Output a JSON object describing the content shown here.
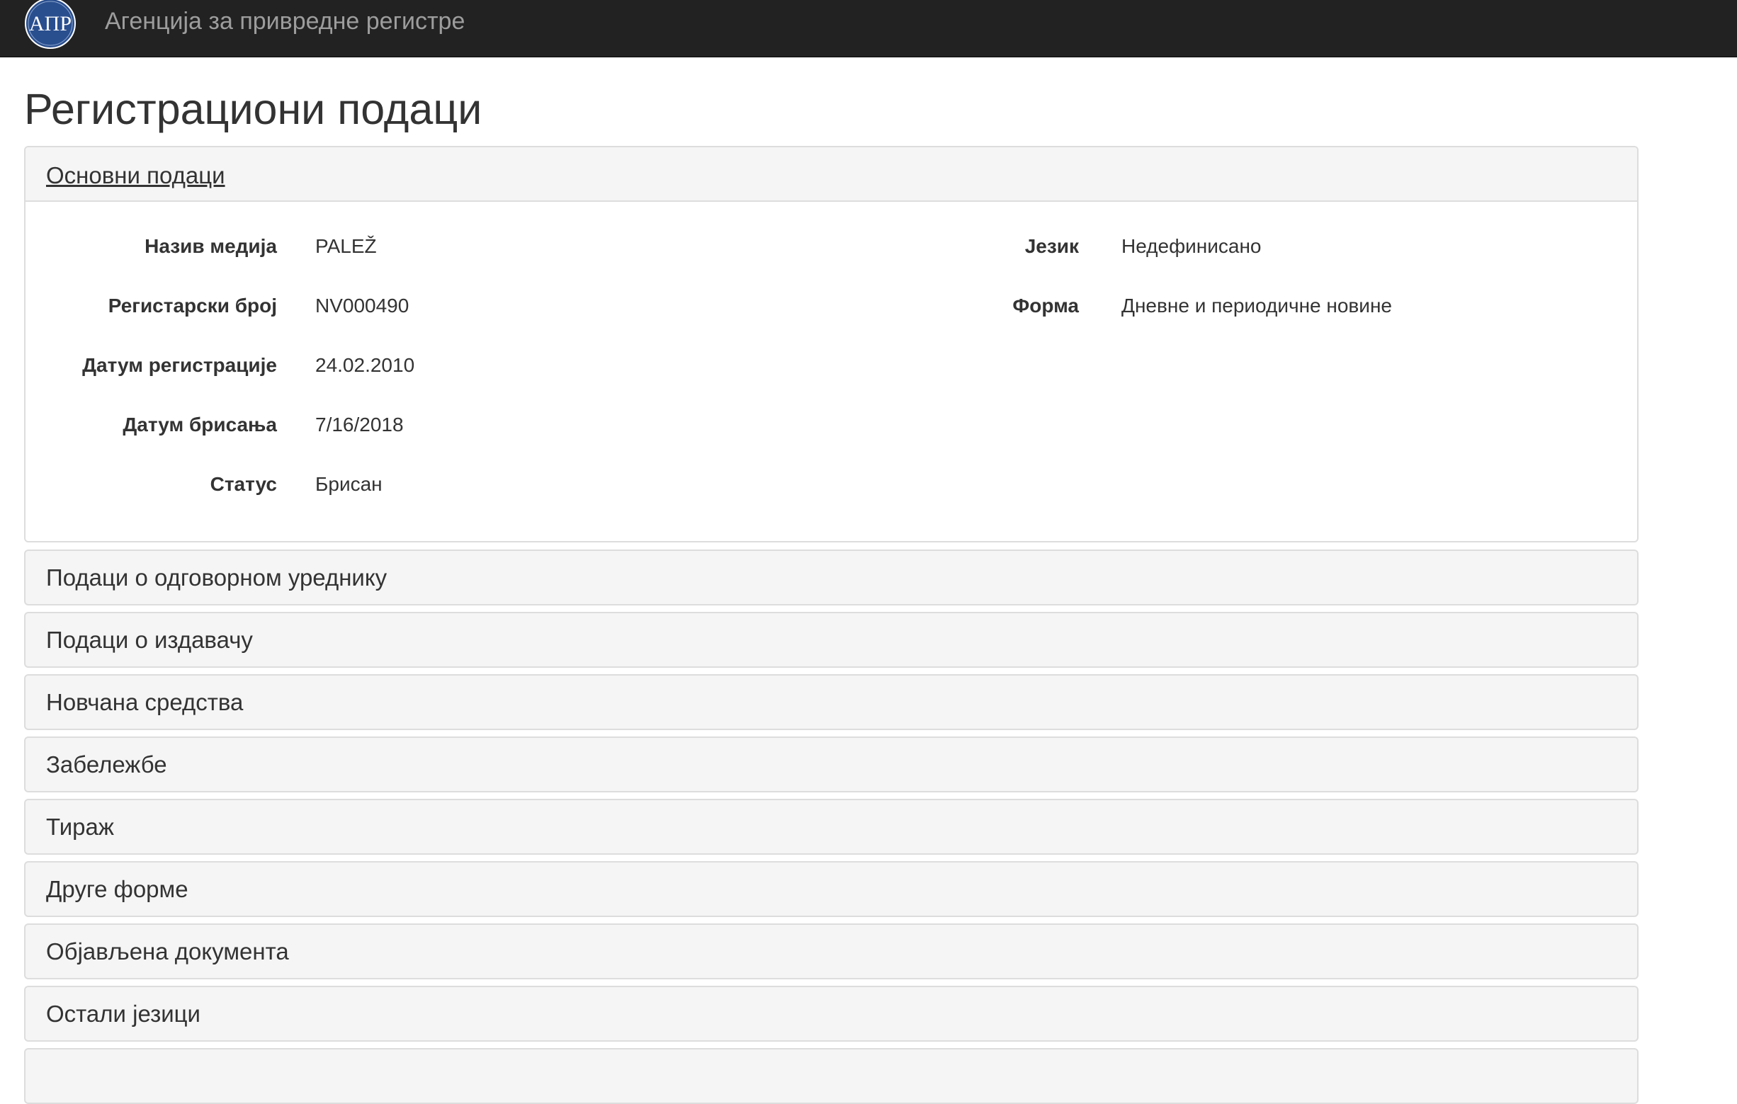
{
  "navbar": {
    "brand": "Агенција за привредне регистре",
    "logo_text": "АПР",
    "logo_color": "#2a4f8f"
  },
  "page": {
    "title": "Регистрациони подаци"
  },
  "basic_panel": {
    "title": "Основни подаци",
    "left_fields": [
      {
        "label": "Назив медија",
        "value": "PALEŽ"
      },
      {
        "label": "Регистарски број",
        "value": "NV000490"
      },
      {
        "label": "Датум регистрације",
        "value": "24.02.2010"
      },
      {
        "label": "Датум брисања",
        "value": "7/16/2018"
      },
      {
        "label": "Статус",
        "value": "Брисан"
      }
    ],
    "right_fields": [
      {
        "label": "Језик",
        "value": "Недефинисано"
      },
      {
        "label": "Форма",
        "value": "Дневне и периодичне новине"
      }
    ]
  },
  "collapsed_panels": [
    {
      "title": "Подаци о одговорном уреднику"
    },
    {
      "title": "Подаци о издавачу"
    },
    {
      "title": "Новчана средства"
    },
    {
      "title": "Забележбе"
    },
    {
      "title": "Тираж"
    },
    {
      "title": "Друге форме"
    },
    {
      "title": "Објављена документа"
    },
    {
      "title": "Остали језици"
    },
    {
      "title": ""
    }
  ]
}
